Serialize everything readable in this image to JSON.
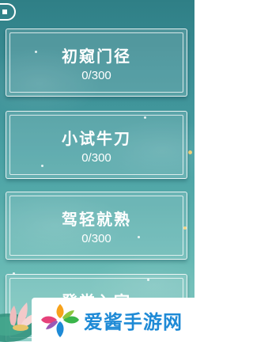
{
  "levels": [
    {
      "name": "初窥门径",
      "progress": "0/300"
    },
    {
      "name": "小试牛刀",
      "progress": "0/300"
    },
    {
      "name": "驾轻就熟",
      "progress": "0/300"
    },
    {
      "name": "登堂入室",
      "progress": ""
    }
  ],
  "watermark": {
    "text": "爱酱手游网"
  },
  "colors": {
    "background_top": "#2f7f86",
    "background_bottom": "#7fc9c0",
    "card_border": "#ffffff",
    "text": "#ffffff",
    "watermark_text": "#1e8ad6"
  },
  "icons": {
    "back": "back-icon",
    "logo": "watermark-logo-icon",
    "lotus": "lotus-decoration-icon"
  }
}
